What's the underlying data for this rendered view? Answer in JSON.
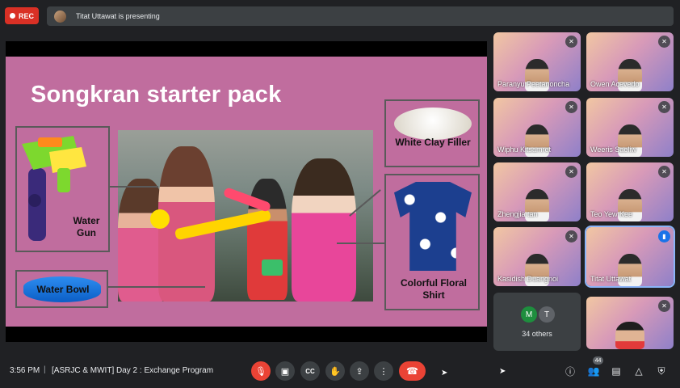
{
  "top": {
    "rec_label": "REC",
    "presenting_text": "Titat Uttawat is presenting"
  },
  "slide": {
    "title": "Songkran starter pack",
    "items": {
      "gun": "Water Gun",
      "bowl": "Water Bowl",
      "clay": "White Clay Filler",
      "shirt": "Colorful Floral Shirt"
    }
  },
  "participants": [
    {
      "name": "Paranyu Peetanoncha",
      "muted": true
    },
    {
      "name": "Owen Acevedo",
      "muted": true
    },
    {
      "name": "Wiphu Kitsamret",
      "muted": true
    },
    {
      "name": "Weeris Saeliw",
      "muted": true
    },
    {
      "name": "Zhengjia tan",
      "muted": true
    },
    {
      "name": "Teo Yew Kee",
      "muted": true
    },
    {
      "name": "Kasidish Duangnoi",
      "muted": true
    },
    {
      "name": "Titat Uttawat",
      "muted": false
    },
    {
      "name": "",
      "muted": true
    }
  ],
  "others": {
    "initials": [
      "M",
      "T"
    ],
    "label": "34 others",
    "colors": [
      "#1e8e3e",
      "#5f6368"
    ]
  },
  "bottom": {
    "time": "3:56 PM",
    "separator": "|",
    "meeting_name": "[ASRJC & MWIT] Day 2 : Exchange Program",
    "people_count": "44"
  },
  "colors": {
    "accent_red": "#ea4335",
    "slide_bg": "#c06d9e",
    "bar_bg": "#202124"
  },
  "icons": {
    "mic": "mic-off-icon",
    "cam": "camera-icon",
    "cc": "captions-icon",
    "hand": "raise-hand-icon",
    "present": "present-icon",
    "more": "more-vert-icon",
    "end": "end-call-icon",
    "info": "info-icon",
    "people": "people-icon",
    "chat": "chat-icon",
    "activities": "activities-icon",
    "host": "host-controls-icon"
  }
}
